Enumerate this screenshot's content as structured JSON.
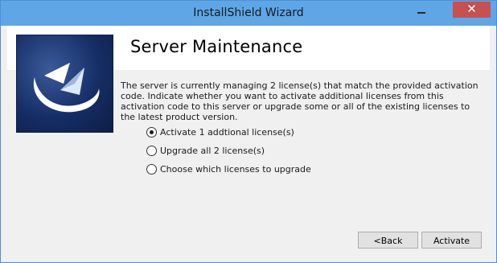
{
  "window": {
    "title": "InstallShield Wizard"
  },
  "titlebar": {
    "close_glyph": "✕"
  },
  "page": {
    "title": "Server Maintenance",
    "description": "The server is currently managing 2 license(s) that match the provided activation code. Indicate whether you want to activate additional licenses from this activation code to this server or upgrade some or all of the existing licenses to the latest product version."
  },
  "options": [
    {
      "label": "Activate 1 addtional license(s)",
      "selected": true
    },
    {
      "label": "Upgrade all 2 license(s)",
      "selected": false
    },
    {
      "label": "Choose which licenses to upgrade",
      "selected": false
    }
  ],
  "buttons": {
    "back_label": "<Back",
    "activate_label": "Activate"
  },
  "colors": {
    "titlebar": "#5ea6e6",
    "close": "#c75050",
    "logo_dark": "#0d1d46"
  }
}
